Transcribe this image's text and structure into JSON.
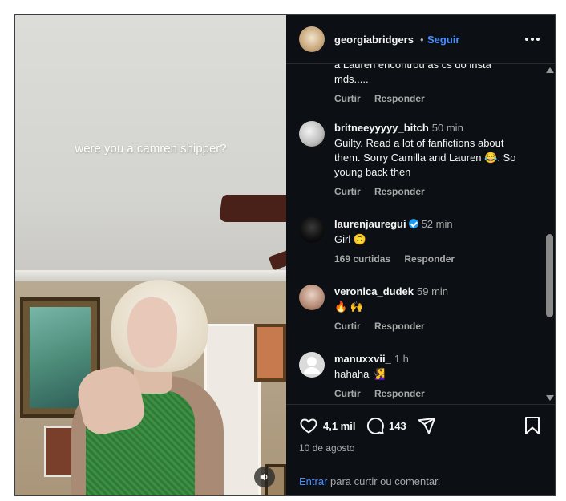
{
  "video": {
    "overlay_text": "were you a camren shipper?",
    "mute_icon": "speaker-icon"
  },
  "header": {
    "username": "georgiabridgers",
    "separator": "•",
    "follow_label": "Seguir",
    "more_icon": "more-horizontal-icon"
  },
  "partial_comment": {
    "text": "a Lauren encontrou as cs do insta mds....."
  },
  "comments": [
    {
      "username": "",
      "time": "",
      "text": "",
      "actions": [
        "Curtir",
        "Responder"
      ]
    },
    {
      "username": "britneeyyyyy_bitch",
      "time": "50 min",
      "text": "Guilty. Read a lot of fanfictions about them. Sorry Camilla and Lauren 😂. So young back then",
      "actions": [
        "Curtir",
        "Responder"
      ]
    },
    {
      "username": "laurenjauregui",
      "verified": true,
      "time": "52 min",
      "text": "Girl 🙃",
      "actions": [
        "169 curtidas",
        "Responder"
      ]
    },
    {
      "username": "veronica_dudek",
      "time": "59 min",
      "text": "🔥 🙌",
      "actions": [
        "Curtir",
        "Responder"
      ]
    },
    {
      "username": "manuxxvii_",
      "time": "1 h",
      "text": "hahaha 🧏‍♀️",
      "actions": [
        "Curtir",
        "Responder"
      ]
    }
  ],
  "footer": {
    "likes": "4,1 mil",
    "comments": "143",
    "date": "10 de agosto",
    "login_link": "Entrar",
    "login_rest": " para curtir ou comentar."
  },
  "colors": {
    "background": "#0c1014",
    "accent_link": "#4a8dff",
    "muted_text": "#a8a8a8",
    "primary_text": "#f5f5f5"
  }
}
